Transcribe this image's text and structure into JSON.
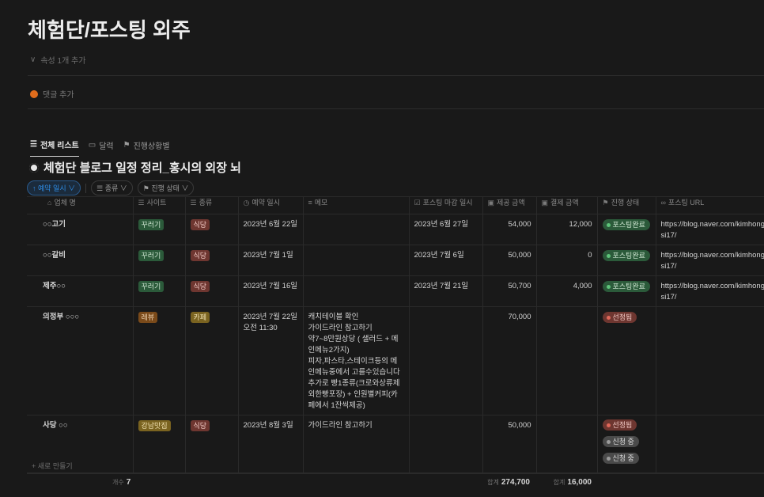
{
  "page": {
    "title": "체험단/포스팅 외주",
    "properties_toggle": "속성 1개 추가",
    "comment_add": "댓글 추가"
  },
  "views": [
    {
      "label": "전체 리스트",
      "icon": "list-icon",
      "active": true
    },
    {
      "label": "달력",
      "icon": "calendar-icon",
      "active": false
    },
    {
      "label": "진행상황별",
      "icon": "board-icon",
      "active": false
    }
  ],
  "database": {
    "title": "체험단 블로그 일정 정리_홍시의 외장 뇌",
    "filters": {
      "sort_label": "↑ 예약 일시 ∨",
      "filter1": "종류 ∨",
      "filter2": "진행 상태 ∨"
    },
    "columns": [
      "업체 명",
      "사이트",
      "종류",
      "예약 일시",
      "메모",
      "포스팅 마감 일시",
      "제공 금액",
      "결제 금액",
      "진행 상태",
      "포스팅 URL"
    ],
    "rows": [
      {
        "name": "○○고기",
        "site": {
          "label": "꾸러기",
          "color": "green"
        },
        "type": {
          "label": "식당",
          "color": "red"
        },
        "reservation": "2023년 6월 22일",
        "memo": "",
        "deadline": "2023년 6월 27일",
        "provided": "54,000",
        "paid": "12,000",
        "statuses": [
          {
            "label": "포스팅완료",
            "color": "green"
          }
        ],
        "url": "https://blog.naver.com/kimhongsi17/"
      },
      {
        "name": "○○갈비",
        "site": {
          "label": "꾸러기",
          "color": "green"
        },
        "type": {
          "label": "식당",
          "color": "red"
        },
        "reservation": "2023년 7월 1일",
        "memo": "",
        "deadline": "2023년 7월 6일",
        "provided": "50,000",
        "paid": "0",
        "statuses": [
          {
            "label": "포스팅완료",
            "color": "green"
          }
        ],
        "url": "https://blog.naver.com/kimhongsi17/"
      },
      {
        "name": "제주○○",
        "site": {
          "label": "꾸러기",
          "color": "green"
        },
        "type": {
          "label": "식당",
          "color": "red"
        },
        "reservation": "2023년 7월 16일",
        "memo": "",
        "deadline": "2023년 7월 21일",
        "provided": "50,700",
        "paid": "4,000",
        "statuses": [
          {
            "label": "포스팅완료",
            "color": "green"
          }
        ],
        "url": "https://blog.naver.com/kimhongsi17/"
      },
      {
        "name": "의정부 ○○○",
        "site": {
          "label": "레뷰",
          "color": "orange"
        },
        "type": {
          "label": "카페",
          "color": "yellow"
        },
        "reservation": "2023년 7월 22일\n오전 11:30",
        "memo": "캐치테이블 확인\n가이드라인 참고하기\n약7~8만원상당 ( 샐러드 + 메인메뉴2가지)\n피자,파스타,스테이크등의 메인메뉴중에서 고를수있습니다\n추가로 빵1종류(크로와상류제외한빵포장) + 인원별커피(카페에서 1잔씩제공)",
        "deadline": "",
        "provided": "70,000",
        "paid": "",
        "statuses": [
          {
            "label": "선정됨",
            "color": "red"
          }
        ],
        "url": ""
      },
      {
        "name": "사당 ○○",
        "site": {
          "label": "강남맛집",
          "color": "yellow"
        },
        "type": {
          "label": "식당",
          "color": "red"
        },
        "reservation": "2023년 8월 3일",
        "memo": "가이드라인 참고하기",
        "deadline": "",
        "provided": "50,000",
        "paid": "",
        "statuses": [
          {
            "label": "선정됨",
            "color": "red"
          },
          {
            "label": "신청 중",
            "color": "gray"
          },
          {
            "label": "신청 중",
            "color": "gray"
          }
        ],
        "url": ""
      }
    ],
    "new_row": "+ 새로 만들기",
    "calc": {
      "count_label": "개수",
      "count_value": "7",
      "sum_label": "합계",
      "provided_sum": "274,700",
      "paid_sum": "16,000"
    }
  }
}
